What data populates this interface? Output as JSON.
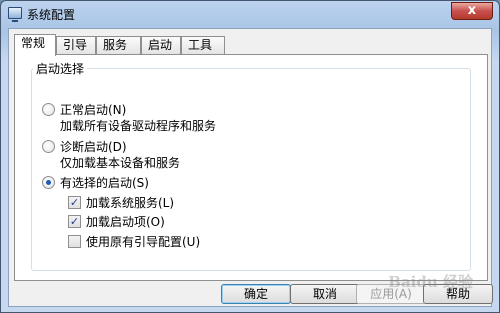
{
  "window": {
    "title": "系统配置",
    "close_symbol": "x"
  },
  "tabs": [
    "常规",
    "引导",
    "服务",
    "启动",
    "工具"
  ],
  "group": {
    "title": "启动选择"
  },
  "options": {
    "normal": {
      "label": "正常启动(N)",
      "desc": "加载所有设备驱动程序和服务",
      "checked": false
    },
    "diagnostic": {
      "label": "诊断启动(D)",
      "desc": "仅加载基本设备和服务",
      "checked": false
    },
    "selective": {
      "label": "有选择的启动(S)",
      "checked": true
    }
  },
  "checkboxes": [
    {
      "label": "加载系统服务(L)",
      "checked": true
    },
    {
      "label": "加载启动项(O)",
      "checked": true
    },
    {
      "label": "使用原有引导配置(U)",
      "checked": false
    }
  ],
  "buttons": {
    "ok": "确定",
    "cancel": "取消",
    "apply": "应用(A)",
    "help": "帮助"
  },
  "watermark": "Baidu 经验"
}
